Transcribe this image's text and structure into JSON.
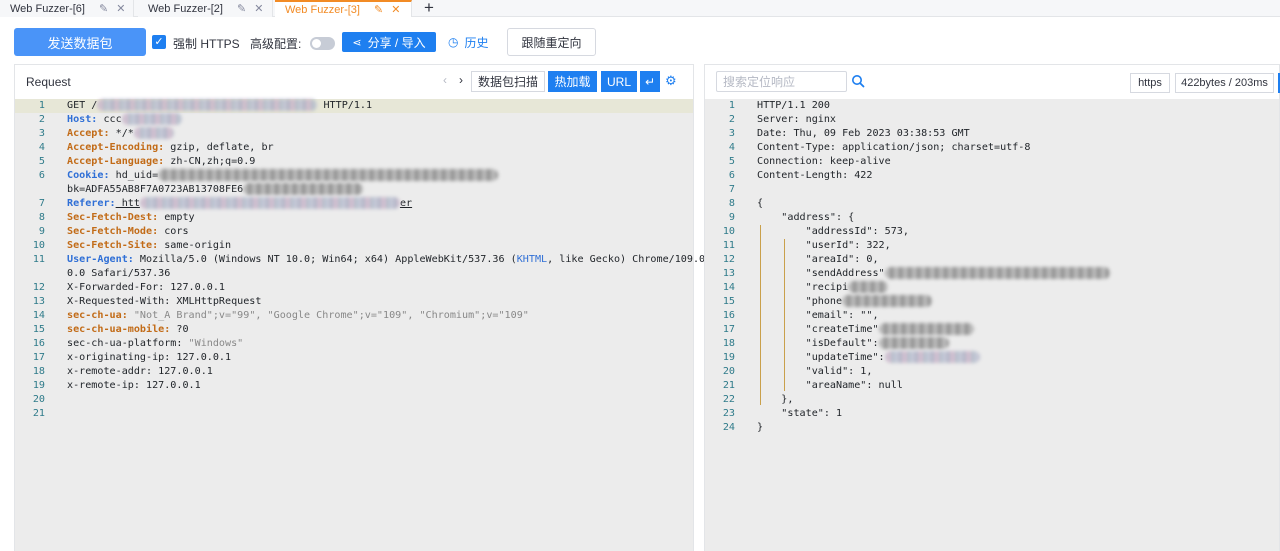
{
  "tabs": [
    {
      "label": "Web Fuzzer-[6]",
      "active": false
    },
    {
      "label": "Web Fuzzer-[2]",
      "active": false
    },
    {
      "label": "Web Fuzzer-[3]",
      "active": true
    }
  ],
  "tab_add_label": "+",
  "toolbar": {
    "send_label": "发送数据包",
    "force_https_label": "强制 HTTPS",
    "force_https_checked": true,
    "advanced_label": "高级配置:",
    "advanced_enabled": false,
    "share_label": "分享 / 导入",
    "history_label": "历史",
    "redirect_label": "跟随重定向"
  },
  "request_panel": {
    "title": "Request",
    "scan_label": "数据包扫描",
    "hotload_label": "热加载",
    "url_label": "URL",
    "wrap_label": "↵",
    "lines": [
      {
        "n": "1",
        "parts": [
          {
            "t": "GET /"
          },
          {
            "blur": 220
          },
          {
            "t": " HTTP/1.1"
          }
        ]
      },
      {
        "n": "2",
        "parts": [
          {
            "t": "Host:",
            "c": "hname blue"
          },
          {
            "t": " ccc"
          },
          {
            "blur": 60
          }
        ]
      },
      {
        "n": "3",
        "parts": [
          {
            "t": "Accept:",
            "c": "hname"
          },
          {
            "t": " */*"
          },
          {
            "blur": 40
          }
        ]
      },
      {
        "n": "4",
        "parts": [
          {
            "t": "Accept-Encoding:",
            "c": "hname"
          },
          {
            "t": " gzip, deflate, br"
          }
        ]
      },
      {
        "n": "5",
        "parts": [
          {
            "t": "Accept-Language:",
            "c": "hname"
          },
          {
            "t": " zh-CN,zh;q=0.9"
          }
        ]
      },
      {
        "n": "6",
        "parts": [
          {
            "t": "Cookie:",
            "c": "hname blue"
          },
          {
            "t": " hd_uid="
          },
          {
            "blur": 340,
            "gray": true
          }
        ]
      },
      {
        "n": "",
        "parts": [
          {
            "t": "bk=ADFA55AB8F7A0723AB13708FE6"
          },
          {
            "blur": 120,
            "gray": true
          }
        ]
      },
      {
        "n": "7",
        "parts": [
          {
            "t": "Referer:",
            "c": "hname blue"
          },
          {
            "t": " htt",
            "c": "underline"
          },
          {
            "blur": 260
          },
          {
            "t": "er",
            "c": "underline"
          }
        ]
      },
      {
        "n": "8",
        "parts": [
          {
            "t": "Sec-Fetch-Dest:",
            "c": "hname"
          },
          {
            "t": " empty"
          }
        ]
      },
      {
        "n": "9",
        "parts": [
          {
            "t": "Sec-Fetch-Mode:",
            "c": "hname"
          },
          {
            "t": " cors"
          }
        ]
      },
      {
        "n": "10",
        "parts": [
          {
            "t": "Sec-Fetch-Site:",
            "c": "hname"
          },
          {
            "t": " same-origin"
          }
        ]
      },
      {
        "n": "11",
        "parts": [
          {
            "t": "User-Agent:",
            "c": "hname blue"
          },
          {
            "t": " Mozilla/5.0 (Windows NT 10.0; Win64; x64) AppleWebKit/537.36 ("
          },
          {
            "t": "KHTML",
            "c": "kw-blue"
          },
          {
            "t": ", like Gecko) Chrome/109.0."
          }
        ]
      },
      {
        "n": "",
        "parts": [
          {
            "t": "0.0 Safari/537.36"
          }
        ]
      },
      {
        "n": "12",
        "parts": [
          {
            "t": "X-Forwarded-For: 127.0.0.1"
          }
        ]
      },
      {
        "n": "13",
        "parts": [
          {
            "t": "X-Requested-With: XMLHttpRequest"
          }
        ]
      },
      {
        "n": "14",
        "parts": [
          {
            "t": "sec-ch-ua:",
            "c": "hname"
          },
          {
            "t": " \"Not_A Brand\";v=\"99\", \"Google Chrome\";v=\"109\", \"Chromium\";v=\"109\"",
            "c": "str"
          }
        ]
      },
      {
        "n": "15",
        "parts": [
          {
            "t": "sec-ch-ua-mobile:",
            "c": "hname"
          },
          {
            "t": " ?0"
          }
        ]
      },
      {
        "n": "16",
        "parts": [
          {
            "t": "sec-ch-ua-platform:"
          },
          {
            "t": " \"Windows\"",
            "c": "str"
          }
        ]
      },
      {
        "n": "17",
        "parts": [
          {
            "t": "x-originating-ip: 127.0.0.1"
          }
        ]
      },
      {
        "n": "18",
        "parts": [
          {
            "t": "x-remote-addr: 127.0.0.1"
          }
        ]
      },
      {
        "n": "19",
        "parts": [
          {
            "t": "x-remote-ip: 127.0.0.1"
          }
        ]
      },
      {
        "n": "20",
        "parts": []
      },
      {
        "n": "21",
        "parts": []
      }
    ]
  },
  "response_panel": {
    "search_placeholder": "搜索定位响应",
    "protocol_badge": "https",
    "size_badge": "422bytes / 203ms",
    "lines": [
      {
        "n": "1",
        "parts": [
          {
            "t": "HTTP/1.1 200"
          }
        ]
      },
      {
        "n": "2",
        "parts": [
          {
            "t": "Server: nginx"
          }
        ]
      },
      {
        "n": "3",
        "parts": [
          {
            "t": "Date: Thu, 09 Feb 2023 03:38:53 GMT"
          }
        ]
      },
      {
        "n": "4",
        "parts": [
          {
            "t": "Content-Type: application/json; charset=utf-8"
          }
        ]
      },
      {
        "n": "5",
        "parts": [
          {
            "t": "Connection: keep-alive"
          }
        ]
      },
      {
        "n": "6",
        "parts": [
          {
            "t": "Content-Length: 422"
          }
        ]
      },
      {
        "n": "7",
        "parts": []
      },
      {
        "n": "8",
        "parts": [
          {
            "t": "{"
          }
        ]
      },
      {
        "n": "9",
        "parts": [
          {
            "t": "    \"address\": {"
          }
        ]
      },
      {
        "n": "10",
        "parts": [
          {
            "t": "        \"addressId\": 573,"
          }
        ]
      },
      {
        "n": "11",
        "parts": [
          {
            "t": "        \"userId\": 322,"
          }
        ]
      },
      {
        "n": "12",
        "parts": [
          {
            "t": "        \"areaId\": 0,"
          }
        ]
      },
      {
        "n": "13",
        "parts": [
          {
            "t": "        \"sendAddress\""
          },
          {
            "blur": 225,
            "gray": true
          }
        ]
      },
      {
        "n": "14",
        "parts": [
          {
            "t": "        \"recipi"
          },
          {
            "blur": 40,
            "gray": true
          }
        ]
      },
      {
        "n": "15",
        "parts": [
          {
            "t": "        \"phone"
          },
          {
            "blur": 90,
            "gray": true
          }
        ]
      },
      {
        "n": "16",
        "parts": [
          {
            "t": "        \"email\": \"\","
          }
        ]
      },
      {
        "n": "17",
        "parts": [
          {
            "t": "        \"createTime\""
          },
          {
            "blur": 95,
            "gray": true
          }
        ]
      },
      {
        "n": "18",
        "parts": [
          {
            "t": "        \"isDefault\":"
          },
          {
            "blur": 70,
            "gray": true
          }
        ]
      },
      {
        "n": "19",
        "parts": [
          {
            "t": "        \"updateTime\":"
          },
          {
            "blur": 95
          }
        ]
      },
      {
        "n": "20",
        "parts": [
          {
            "t": "        \"valid\": 1,"
          }
        ]
      },
      {
        "n": "21",
        "parts": [
          {
            "t": "        \"areaName\": null"
          }
        ]
      },
      {
        "n": "22",
        "parts": [
          {
            "t": "    },"
          }
        ]
      },
      {
        "n": "23",
        "parts": [
          {
            "t": "    \"state\": 1"
          }
        ]
      },
      {
        "n": "24",
        "parts": [
          {
            "t": "}"
          }
        ]
      }
    ]
  }
}
